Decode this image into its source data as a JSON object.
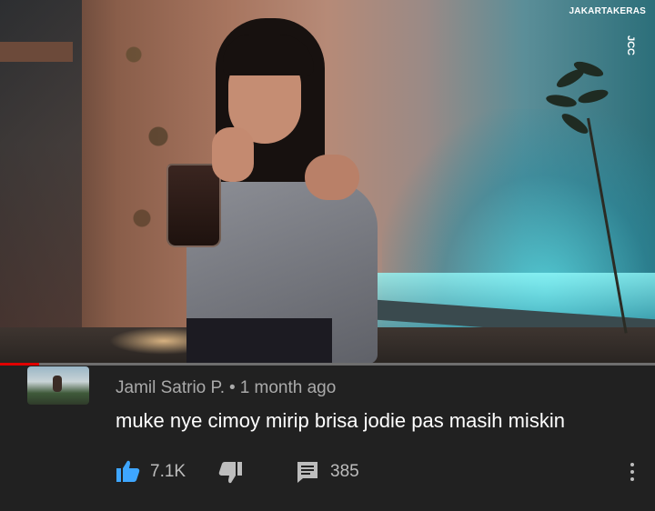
{
  "photo": {
    "watermark": "JAKARTAKERAS",
    "vertical_logo": "JCC"
  },
  "video_progress": {
    "fraction": 0.06,
    "played_color": "#e00000",
    "track_color": "#6e6e6e"
  },
  "comment": {
    "author": "Jamil Satrio P.",
    "separator": "•",
    "time": "1 month ago",
    "text": "muke nye cimoy mirip brisa jodie pas masih miskin",
    "likes": "7.1K",
    "replies": "385",
    "like_icon": "thumbs-up-icon",
    "dislike_icon": "thumbs-down-icon",
    "reply_icon": "comment-icon",
    "more_icon": "more-vert-icon",
    "like_color": "#3ea6ff",
    "icon_color": "#bdbdbd"
  }
}
